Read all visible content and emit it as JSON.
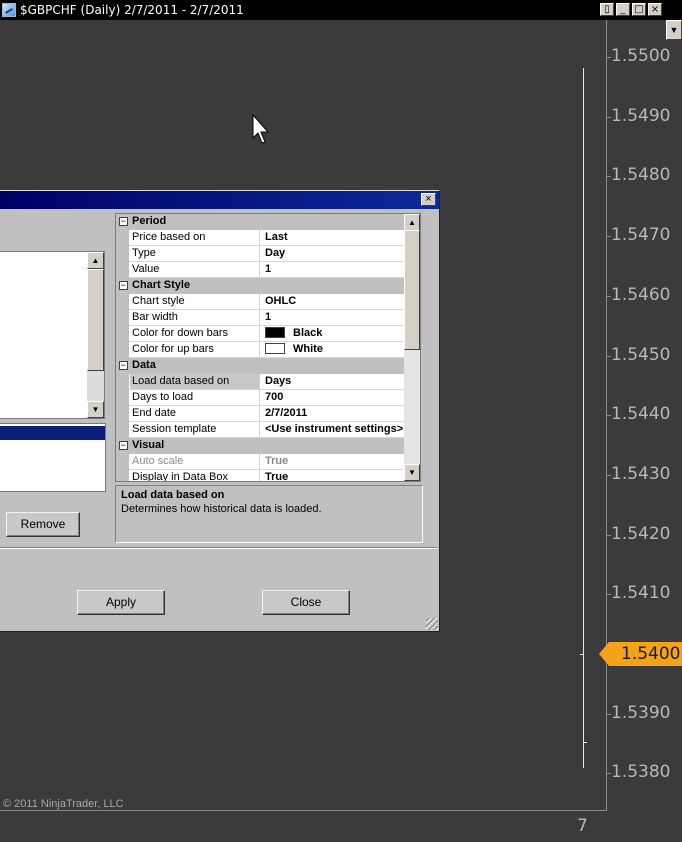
{
  "window": {
    "title": "$GBPCHF (Daily)  2/7/2011 - 2/7/2011",
    "buttons": {
      "restore": "▯",
      "minimize": "_",
      "maximize": "□",
      "close": "×"
    }
  },
  "chart": {
    "price_labels": [
      "1.5500",
      "1.5490",
      "1.5480",
      "1.5470",
      "1.5460",
      "1.5450",
      "1.5440",
      "1.5430",
      "1.5420",
      "1.5410",
      "1.5400",
      "1.5390",
      "1.5380"
    ],
    "current_price": "1.5400",
    "x_label": "7",
    "copyright": "© 2011 NinjaTrader, LLC",
    "accent_color": "#f5a21b"
  },
  "dialog": {
    "remove_label": "Remove",
    "apply_label": "Apply",
    "close_label": "Close",
    "properties": [
      {
        "category": "Period",
        "rows": [
          {
            "name": "Price based on",
            "value": "Last"
          },
          {
            "name": "Type",
            "value": "Day"
          },
          {
            "name": "Value",
            "value": "1"
          }
        ]
      },
      {
        "category": "Chart Style",
        "rows": [
          {
            "name": "Chart style",
            "value": "OHLC"
          },
          {
            "name": "Bar width",
            "value": "1"
          },
          {
            "name": "Color for down bars",
            "value": "Black",
            "swatch": "#000000"
          },
          {
            "name": "Color for up bars",
            "value": "White",
            "swatch": "#ffffff"
          }
        ]
      },
      {
        "category": "Data",
        "rows": [
          {
            "name": "Load data based on",
            "value": "Days",
            "selected": true
          },
          {
            "name": "Days to load",
            "value": "700"
          },
          {
            "name": "End date",
            "value": "2/7/2011"
          },
          {
            "name": "Session template",
            "value": "<Use instrument settings>"
          }
        ]
      },
      {
        "category": "Visual",
        "rows": [
          {
            "name": "Auto scale",
            "value": "True",
            "disabled": true
          },
          {
            "name": "Display in Data Box",
            "value": "True"
          }
        ]
      }
    ],
    "help": {
      "title": "Load data based on",
      "description": "Determines how historical data is loaded."
    }
  }
}
